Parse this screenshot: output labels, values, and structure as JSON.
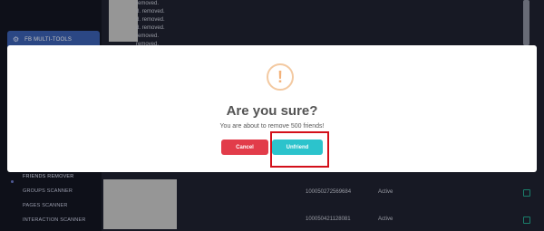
{
  "sidebar": {
    "main_button": {
      "icon": "tools-icon",
      "label": "FB MULTI-TOOLS"
    },
    "items": [
      {
        "label": "FRIENDS REMOVER",
        "active": true
      },
      {
        "label": "GROUPS SCANNER"
      },
      {
        "label": "PAGES SCANNER"
      },
      {
        "label": "INTERACTION SCANNER"
      }
    ]
  },
  "log": {
    "lines": [
      "removed.",
      "d. removed.",
      "d. removed.",
      "d. removed.",
      "removed.",
      "removed."
    ]
  },
  "table": {
    "rows": [
      {
        "id": "100050272569684",
        "status": "Active"
      },
      {
        "id": "100050421128081",
        "status": "Active"
      }
    ]
  },
  "modal": {
    "icon": "warning-icon",
    "icon_glyph": "!",
    "title": "Are you sure?",
    "message": "You are about to remove 500 friends!",
    "cancel_label": "Cancel",
    "confirm_label": "Unfriend"
  },
  "colors": {
    "cancel": "#e23c4a",
    "confirm": "#2cc3cc",
    "highlight": "#d3101a",
    "warning": "#f3b27a"
  }
}
